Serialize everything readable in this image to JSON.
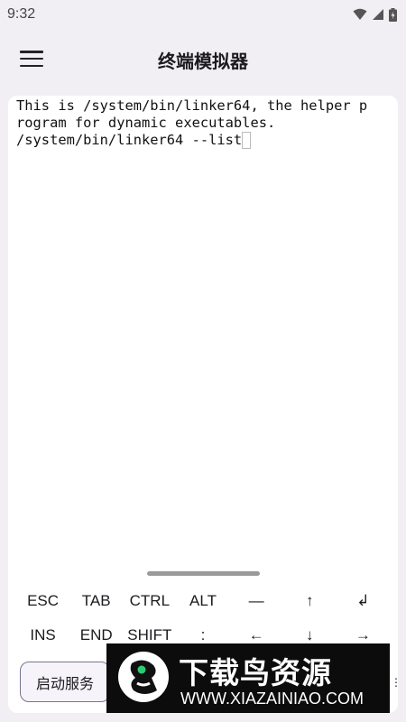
{
  "status_bar": {
    "time": "9:32",
    "icons": [
      "wifi-icon",
      "cellular-signal-icon",
      "battery-icon"
    ]
  },
  "app_bar": {
    "menu_icon": "hamburger-menu-icon",
    "title": "终端模拟器"
  },
  "terminal": {
    "lines": [
      "This is /system/bin/linker64, the helper p",
      "rogram for dynamic executables.",
      "/system/bin/linker64 --list"
    ]
  },
  "extra_keys": {
    "row1": [
      "ESC",
      "TAB",
      "CTRL",
      "ALT",
      "—",
      "↑",
      "↲"
    ],
    "row2": [
      "INS",
      "END",
      "SHIFT",
      ":",
      "←",
      "↓",
      "→"
    ]
  },
  "actions": {
    "start_service": "启动服务"
  },
  "watermark": {
    "title": "下载鸟资源",
    "url": "WWW.XIAZAINIAO.COM"
  },
  "colors": {
    "background": "#f1eef4",
    "terminal_bg": "#ffffff",
    "button_border": "#7a7590"
  }
}
